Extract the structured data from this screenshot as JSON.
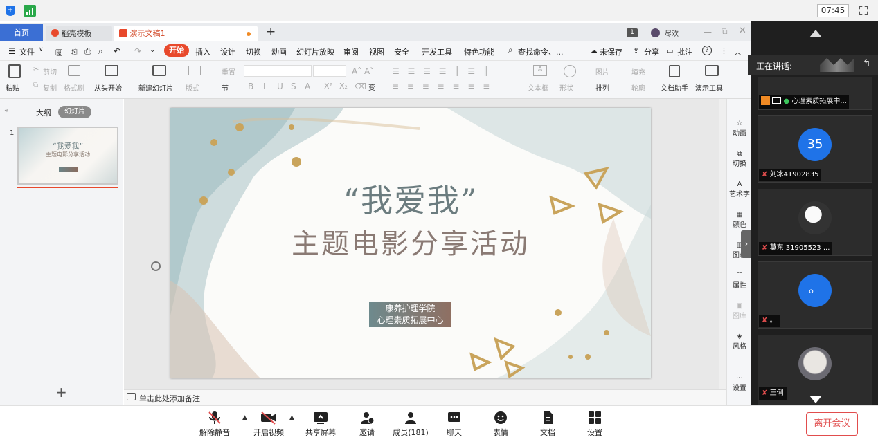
{
  "topbar": {
    "time": "07:45"
  },
  "tabs": [
    {
      "label": "首页"
    },
    {
      "label": "稻壳模板"
    },
    {
      "label": "演示文稿1"
    }
  ],
  "titlebar": {
    "badge": "1",
    "user": "尽欢"
  },
  "menu": {
    "items": [
      "文件",
      "开始",
      "插入",
      "设计",
      "切换",
      "动画",
      "幻灯片放映",
      "审阅",
      "视图",
      "安全",
      "开发工具",
      "特色功能"
    ],
    "search": "查找命令、...",
    "unsaved": "未保存",
    "share": "分享",
    "comment": "批注"
  },
  "ribbon": {
    "paste": "粘贴",
    "cut": "剪切",
    "copy": "复制",
    "format_painter": "格式刷",
    "from_start": "从头开始",
    "new_slide": "新建幻灯片",
    "layout": "版式",
    "reset": "重置",
    "section": "节",
    "font_chars": [
      "B",
      "I",
      "U",
      "S",
      "A",
      "X²",
      "X₂"
    ],
    "char_spacing": "变",
    "textbox": "文本框",
    "shape": "形状",
    "picture": "图片",
    "fill": "填充",
    "arrange": "排列",
    "outline": "轮廓",
    "doc_helper": "文档助手",
    "present_tools": "演示工具"
  },
  "leftpanel": {
    "tab_outline": "大纲",
    "tab_slides": "幻灯片",
    "slide_number": "1",
    "thumb_title": "“我爱我”",
    "thumb_subtitle": "主题电影分享活动"
  },
  "slide": {
    "title": "“我爱我”",
    "subtitle": "主题电影分享活动",
    "org_line1": "康养护理学院",
    "org_line2": "心理素质拓展中心"
  },
  "notes": {
    "placeholder": "单击此处添加备注"
  },
  "rightbar": {
    "items": [
      "动画",
      "切换",
      "艺术字",
      "颜色",
      "图表",
      "属性",
      "图库",
      "风格",
      "设置"
    ]
  },
  "video": {
    "speaking_label": "正在讲话:",
    "speaker_name": "心理素质拓展中...",
    "participants": [
      {
        "initials": "35",
        "name": "刘冰41902835",
        "color": "#1f73e8"
      },
      {
        "name": "莫东 31905523 ..."
      },
      {
        "initials": "。",
        "name": "。",
        "color": "#1f73e8"
      },
      {
        "name": "王俐"
      }
    ]
  },
  "bottombar": {
    "mute": "解除静音",
    "video": "开启视频",
    "share": "共享屏幕",
    "invite": "邀请",
    "members": "成员(181)",
    "chat": "聊天",
    "emoji": "表情",
    "docs": "文档",
    "settings": "设置",
    "leave": "离开会议"
  }
}
